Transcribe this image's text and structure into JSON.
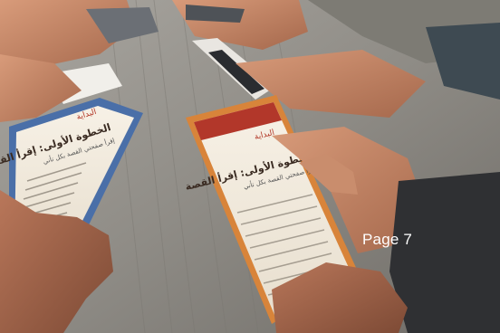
{
  "caption": {
    "page_label": "Page 7"
  },
  "left_phone": {
    "title": "البداية",
    "heading": "الخطوة الأولى: إقرأ القصة",
    "subtitle": "إقرأ صفحتي القصة بكل تأني"
  },
  "right_phone": {
    "title": "البداية",
    "heading": "الخطوة الأولى: إقرأ القصة",
    "subtitle": "إقرأ صفحتي القصة بكل تأني"
  },
  "colors": {
    "table": "#8c8a84",
    "left_phone_case": "#4a6fa8",
    "right_phone_case": "#d8843a",
    "screen": "#f4ede0",
    "header_red": "#b2372a"
  }
}
